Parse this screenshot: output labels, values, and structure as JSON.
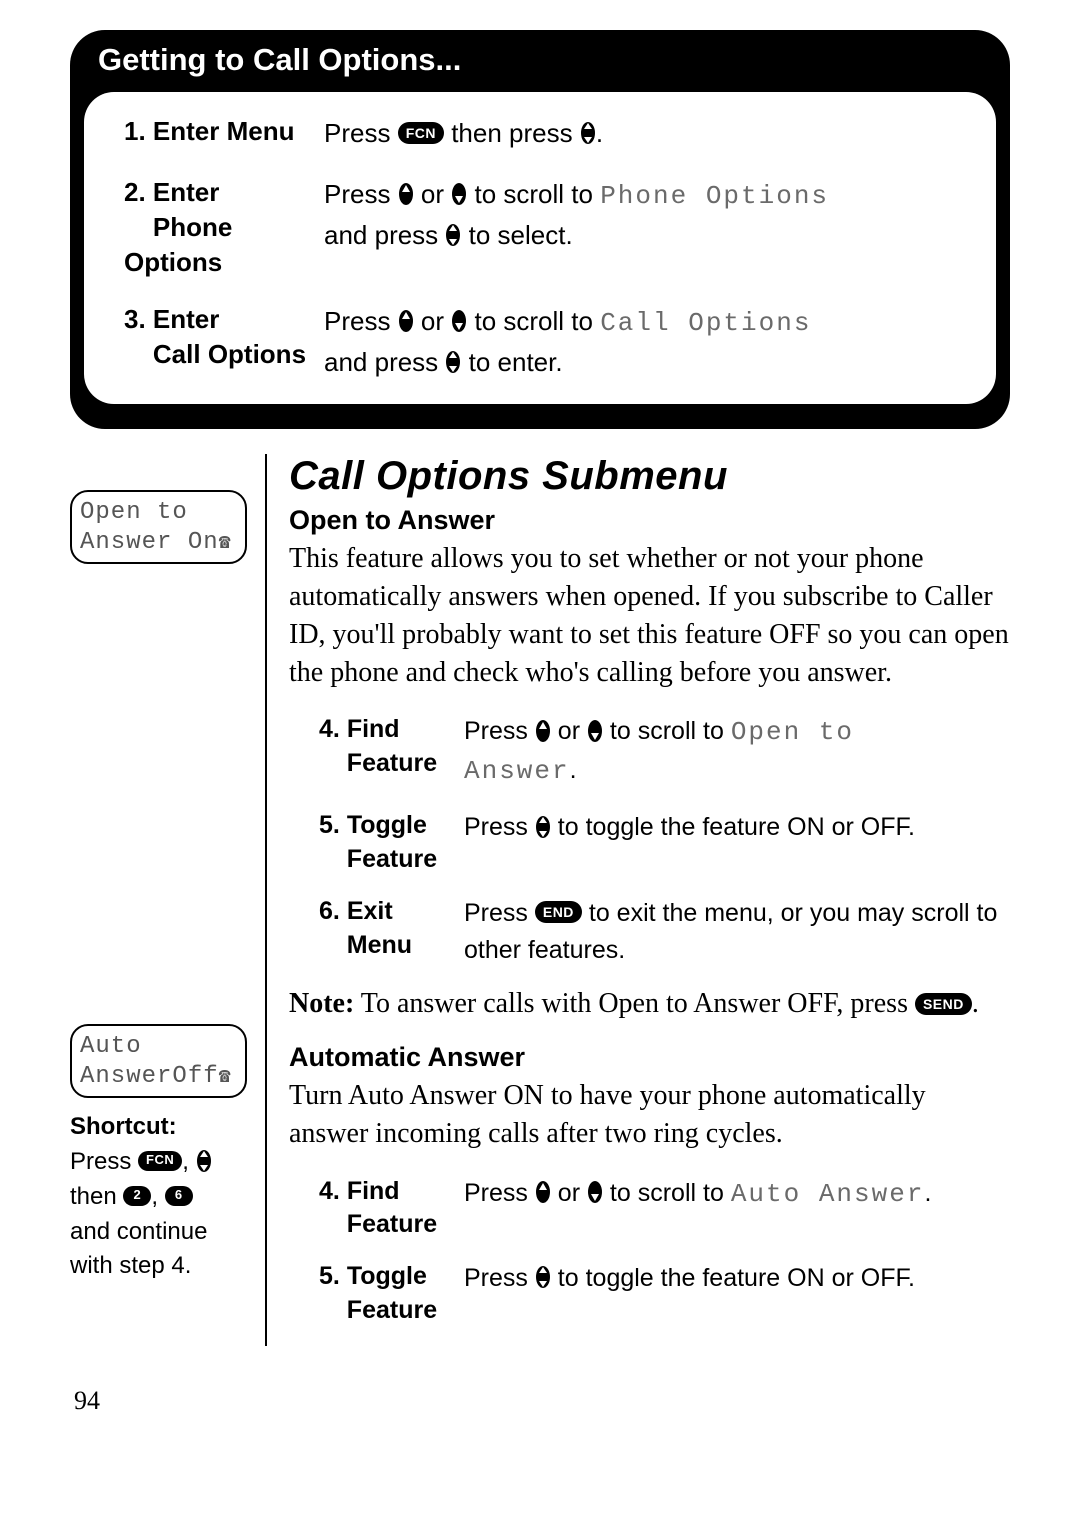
{
  "header": "Getting to Call Options...",
  "steps_top": [
    {
      "n": "1.",
      "label": "Enter Menu",
      "r1": "Press ",
      "icon1": "FCN",
      "r2": " then press ",
      "icon2": "nav-full",
      "r3": "."
    },
    {
      "n": "2.",
      "label1": "Enter",
      "label2": "Phone Options",
      "r1": "Press ",
      "icon1": "nav-up",
      "r2": " or ",
      "icon2": "nav-down",
      "r3": " to scroll to ",
      "lcd": "Phone Options",
      "r4": "and press ",
      "icon3": "nav-full",
      "r5": " to select."
    },
    {
      "n": "3.",
      "label1": "Enter",
      "label2": "Call Options",
      "r1": "Press ",
      "icon1": "nav-up",
      "r2": " or ",
      "icon2": "nav-down",
      "r3": " to scroll to ",
      "lcd": "Call Options",
      "r4": "and press ",
      "icon3": "nav-full",
      "r5": " to enter."
    }
  ],
  "section_title": "Call Options Submenu",
  "open_to_answer": {
    "lcd_line1": "Open to",
    "lcd_line2": "Answer On",
    "title": "Open to Answer",
    "body": "This feature allows you to set whether or not your phone automatically answers when opened. If you subscribe to Caller ID, you'll probably want to set this feature OFF so you can open the phone and check who's calling before you answer.",
    "steps": [
      {
        "n": "4.",
        "label1": "Find",
        "label2": "Feature",
        "r1": "Press ",
        "r2": " or ",
        "r3": " to scroll to ",
        "lcd1": "Open to",
        "lcd2": "Answer",
        "r4": "."
      },
      {
        "n": "5.",
        "label1": "Toggle",
        "label2": "Feature",
        "r1": "Press ",
        "r2": " to toggle the feature ON or OFF."
      },
      {
        "n": "6.",
        "label1": "Exit",
        "label2": "Menu",
        "r1": "Press ",
        "pill": "END",
        "r2": " to exit the menu, or you may scroll to other features."
      }
    ],
    "note_b": "Note:",
    "note_rest": " To answer calls with Open to Answer OFF, press ",
    "note_pill": "SEND",
    "note_end": "."
  },
  "auto_answer": {
    "lcd_line1": "Auto",
    "lcd_line2": "AnswerOff",
    "title": "Automatic Answer",
    "body": "Turn Auto Answer ON to have your phone automatically answer incoming calls after two ring cycles.",
    "steps": [
      {
        "n": "4.",
        "label1": "Find",
        "label2": "Feature",
        "r1": "Press ",
        "r2": " or ",
        "r3": " to scroll to ",
        "lcd": "Auto Answer",
        "r4": "."
      },
      {
        "n": "5.",
        "label1": "Toggle",
        "label2": "Feature",
        "r1": "Press ",
        "r2": " to toggle the feature ON or OFF."
      }
    ]
  },
  "shortcut": {
    "title": "Shortcut:",
    "l1a": "Press ",
    "p1": "FCN",
    "l1b": ", ",
    "l2a": "then ",
    "p2": "2",
    "l2b": ", ",
    "p3": "6",
    "l3": "and continue with step 4."
  },
  "page_number": "94"
}
